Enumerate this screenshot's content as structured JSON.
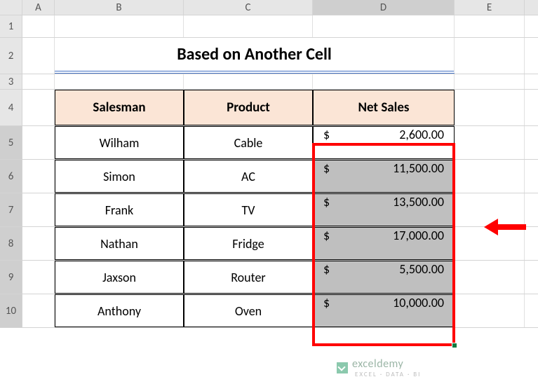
{
  "columns": [
    "A",
    "B",
    "C",
    "D",
    "E"
  ],
  "rows": [
    "1",
    "2",
    "3",
    "4",
    "5",
    "6",
    "7",
    "8",
    "9",
    "10"
  ],
  "title": "Based on Another Cell",
  "headers": {
    "salesman": "Salesman",
    "product": "Product",
    "netsales": "Net Sales"
  },
  "data": [
    {
      "salesman": "Wilham",
      "product": "Cable",
      "sales": "2,600.00",
      "highlighted": false
    },
    {
      "salesman": "Simon",
      "product": "AC",
      "sales": "11,500.00",
      "highlighted": true
    },
    {
      "salesman": "Frank",
      "product": "TV",
      "sales": "13,500.00",
      "highlighted": true
    },
    {
      "salesman": "Nathan",
      "product": "Fridge",
      "sales": "17,000.00",
      "highlighted": true
    },
    {
      "salesman": "Jaxson",
      "product": "Router",
      "sales": "5,500.00",
      "highlighted": true
    },
    {
      "salesman": "Anthony",
      "product": "Oven",
      "sales": "10,000.00",
      "highlighted": true
    }
  ],
  "currency": "$",
  "watermark": {
    "brand": "exceldemy",
    "tagline": "EXCEL · DATA · BI"
  }
}
